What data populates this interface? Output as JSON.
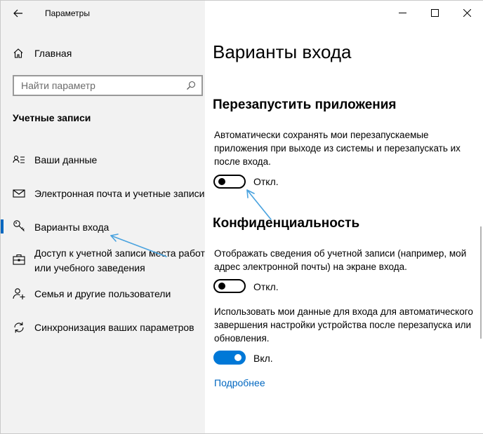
{
  "window": {
    "app_title": "Параметры",
    "controls": [
      "minimize-icon",
      "maximize-icon",
      "close-icon"
    ]
  },
  "sidebar": {
    "home_label": "Главная",
    "search_placeholder": "Найти параметр",
    "section_heading": "Учетные записи",
    "items": [
      {
        "label": "Ваши данные",
        "icon": "person-card-icon",
        "selected": false
      },
      {
        "label": "Электронная почта и учетные записи",
        "icon": "mail-icon",
        "selected": false
      },
      {
        "label": "Варианты входа",
        "icon": "key-icon",
        "selected": true
      },
      {
        "label_line1": "Доступ к учетной записи места работ",
        "label_line2": "или учебного заведения",
        "icon": "briefcase-icon",
        "selected": false
      },
      {
        "label": "Семья и другие пользователи",
        "icon": "person-add-icon",
        "selected": false
      },
      {
        "label": "Синхронизация ваших параметров",
        "icon": "sync-icon",
        "selected": false
      }
    ]
  },
  "main": {
    "page_title": "Варианты входа",
    "restart_apps": {
      "heading": "Перезапустить приложения",
      "description": "Автоматически сохранять мои перезапускаемые приложения при выходе из системы и перезапускать их после входа.",
      "toggle_state": "off",
      "toggle_label": "Откл."
    },
    "privacy": {
      "heading": "Конфиденциальность",
      "account_details": {
        "description": "Отображать сведения об учетной записи (например, мой адрес электронной почты) на экране входа.",
        "toggle_state": "off",
        "toggle_label": "Откл."
      },
      "use_signin_info": {
        "description": "Использовать мои данные для входа для автоматического завершения настройки устройства после перезапуска или обновления.",
        "toggle_state": "on",
        "toggle_label": "Вкл."
      },
      "learn_more": "Подробнее"
    }
  },
  "colors": {
    "accent": "#0078d7",
    "link": "#0067c0",
    "sidebar_bg": "#f2f2f2",
    "annotation_arrow": "#4aa3df"
  }
}
